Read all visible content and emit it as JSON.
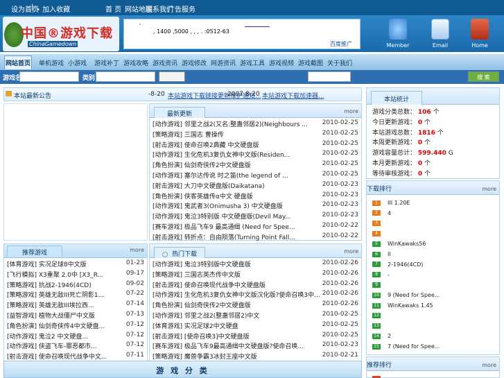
{
  "topbar": {
    "left": "设为首页",
    "sep": "|",
    "right": "• 加入收藏",
    "links": [
      "首 页",
      "网站地图",
      "联系我们",
      "广告服务"
    ]
  },
  "logo": {
    "text": "中国®游戏下载",
    "en": "ChinaGamedown"
  },
  "ad": {
    "mark": "'",
    "line": ", 1400 ,5000 , , , . :0512-63",
    "baidu": "百度推广"
  },
  "header_icons": [
    {
      "name": "member",
      "label": "Member",
      "color": "#5aa0e0"
    },
    {
      "name": "email",
      "label": "Email",
      "color": "#9dc6ea"
    },
    {
      "name": "home",
      "label": "Home",
      "color": "#d9472b"
    }
  ],
  "nav": {
    "items": [
      "网站首页",
      "单机游戏",
      "小游戏",
      "游戏补丁",
      "游戏攻略",
      "游戏资讯",
      "游戏修改",
      "网游资讯",
      "游戏工具",
      "游戏视频",
      "游戏截图",
      "关于我们"
    ]
  },
  "search": {
    "label1": "游戏名称",
    "label2": "类别",
    "button": "搜 索"
  },
  "news_ticker": {
    "title": "本站最新公告",
    "items": [
      {
        "date": "-8-20",
        "text": "本站游戏下载链接更新维护通知..."
      },
      {
        "date": "2007-8-20",
        "text": "本站游戏下载加速器..."
      }
    ]
  },
  "newest": {
    "tab": "最新更新",
    "more": "more",
    "rows": [
      {
        "t": "[动作游戏] 邻里之战2(又名:整蛊邻居2)(Neighbours ...",
        "d": "2010-02-25"
      },
      {
        "t": "[策略游戏] 三国志 曹操传",
        "d": "2010-02-25"
      },
      {
        "t": "[射击游戏] 使命召唤2典藏 中文硬盘版",
        "d": "2010-02-25"
      },
      {
        "t": "[动作游戏] 生化危机3复仇女神中文版(Residen...",
        "d": "2010-02-25"
      },
      {
        "t": "[角色扮演] 仙剑奇侠传2中文硬盘版",
        "d": "2010-02-25"
      },
      {
        "t": "[动作游戏] 塞尔达传说 时之笛(the legend of ...",
        "d": "2010-02-25"
      },
      {
        "t": "[射击游戏] 大刀中文硬盘版(Daikatana)",
        "d": "2010-02-23"
      },
      {
        "t": "[角色扮演] 侠客英雄传α中文 硬盘版",
        "d": "2010-02-23"
      },
      {
        "t": "[动作游戏] 鬼武者3(Onimusha 3) 中文硬盘版",
        "d": "2010-02-23"
      },
      {
        "t": "[动作游戏] 鬼泣3特别版 中文硬盘版(Devil May...",
        "d": "2010-02-23"
      },
      {
        "t": "[赛车游戏] 极品飞车9 最高通缉 (Need for Spee...",
        "d": "2010-02-22"
      },
      {
        "t": "[射击游戏] 转折点：自由陨落(Turning Point Fall...",
        "d": "2010-02-22"
      }
    ]
  },
  "recommend": {
    "tab": "推荐游戏",
    "more": "more",
    "rows": [
      {
        "t": "[体育游戏] 实况足球8中文版",
        "d": "01-23"
      },
      {
        "t": "[飞行模拟] X3重聚 2.0中 [X3_R...",
        "d": "09-17"
      },
      {
        "t": "[策略游戏] 抗战2-1946(4CD)",
        "d": "09-02"
      },
      {
        "t": "[策略游戏] 英雄无敌III死亡阴影1...",
        "d": "07-22"
      },
      {
        "t": "[策略游戏] 英雄无敌III埃拉西...",
        "d": "07-14"
      },
      {
        "t": "[益智游戏] 植物大战僵尸中文版",
        "d": "07-13"
      },
      {
        "t": "[角色扮演] 仙剑奇侠传4中文硬盘...",
        "d": "07-12"
      },
      {
        "t": "[动作游戏] 鬼泣2 中文硬盘...",
        "d": "07-12"
      },
      {
        "t": "[动作游戏] 侠盗飞车-罪恶都市...",
        "d": "07-12"
      },
      {
        "t": "[射击游戏] 使命召唤现代战争中文...",
        "d": "07-11"
      }
    ]
  },
  "hot": {
    "tab": "热门下载",
    "more": "more",
    "rows": [
      {
        "t": "[动作游戏] 鬼泣3特别版中文硬盘版",
        "d": "2010-02-26"
      },
      {
        "t": "[策略游戏] 三国志英杰传中文版",
        "d": "2010-02-26"
      },
      {
        "t": "[射击游戏] 使命召唤现代战争中文硬盘版",
        "d": "2010-02-26"
      },
      {
        "t": "[动作游戏] 生化危机3复仇女神中文版汉化版?使命召唤3中...",
        "d": "2010-02-26"
      },
      {
        "t": "[角色扮演] 仙剑奇侠传2中文硬盘版",
        "d": "2010-02-26"
      },
      {
        "t": "[动作游戏] 邻里之战2(整蛊邻居2)中文",
        "d": "2010-02-25"
      },
      {
        "t": "[体育游戏] 实况足球2中文硬盘",
        "d": "2010-02-25"
      },
      {
        "t": "[射击游戏] [使命召唤3]中文硬盘版",
        "d": "2010-02-25"
      },
      {
        "t": "[赛车游戏] 极品飞车9最高通缉中文硬盘版?使命召唤...",
        "d": "2010-02-23"
      },
      {
        "t": "[策略游戏] 魔兽争霸3冰封王座中文版",
        "d": "2010-02-21"
      }
    ]
  },
  "bottom_title": "游 戏 分 类",
  "stats": {
    "title": "本站统计",
    "rows": [
      {
        "k": "游戏分类总数：",
        "v": "106",
        "u": "个"
      },
      {
        "k": "今日更新游戏：",
        "v": "0",
        "u": "个"
      },
      {
        "k": "本站游戏总数：",
        "v": "1816",
        "u": "个"
      },
      {
        "k": "本周更新游戏：",
        "v": "0",
        "u": "个"
      },
      {
        "k": "游戏容量总计：",
        "v": "599.440",
        "u": "G"
      },
      {
        "k": "本月更新游戏：",
        "v": "0",
        "u": "个"
      },
      {
        "k": "等待审核游戏：",
        "v": "0",
        "u": "个"
      }
    ]
  },
  "rank": {
    "title": "下载排行",
    "more": "more",
    "rows": [
      {
        "n": "1",
        "t": "III 1.20E"
      },
      {
        "n": "2",
        "t": "4"
      },
      {
        "n": "3",
        "t": ""
      },
      {
        "n": "4",
        "t": ""
      },
      {
        "n": "5",
        "t": "WinKawaks56"
      },
      {
        "n": "6",
        "t": "II"
      },
      {
        "n": "7",
        "t": "2-1946(4CD)"
      },
      {
        "n": "8",
        "t": "-"
      },
      {
        "n": "9",
        "t": ""
      },
      {
        "n": "10",
        "t": "9 (Need for Spee..."
      },
      {
        "n": "11",
        "t": "WinKawaks 1.45"
      },
      {
        "n": "12",
        "t": ""
      },
      {
        "n": "13",
        "t": ""
      },
      {
        "n": "14",
        "t": "2"
      },
      {
        "n": "15",
        "t": "7 (Need for Spee..."
      }
    ]
  },
  "rank2": {
    "title": "推荐排行",
    "more": "more"
  }
}
